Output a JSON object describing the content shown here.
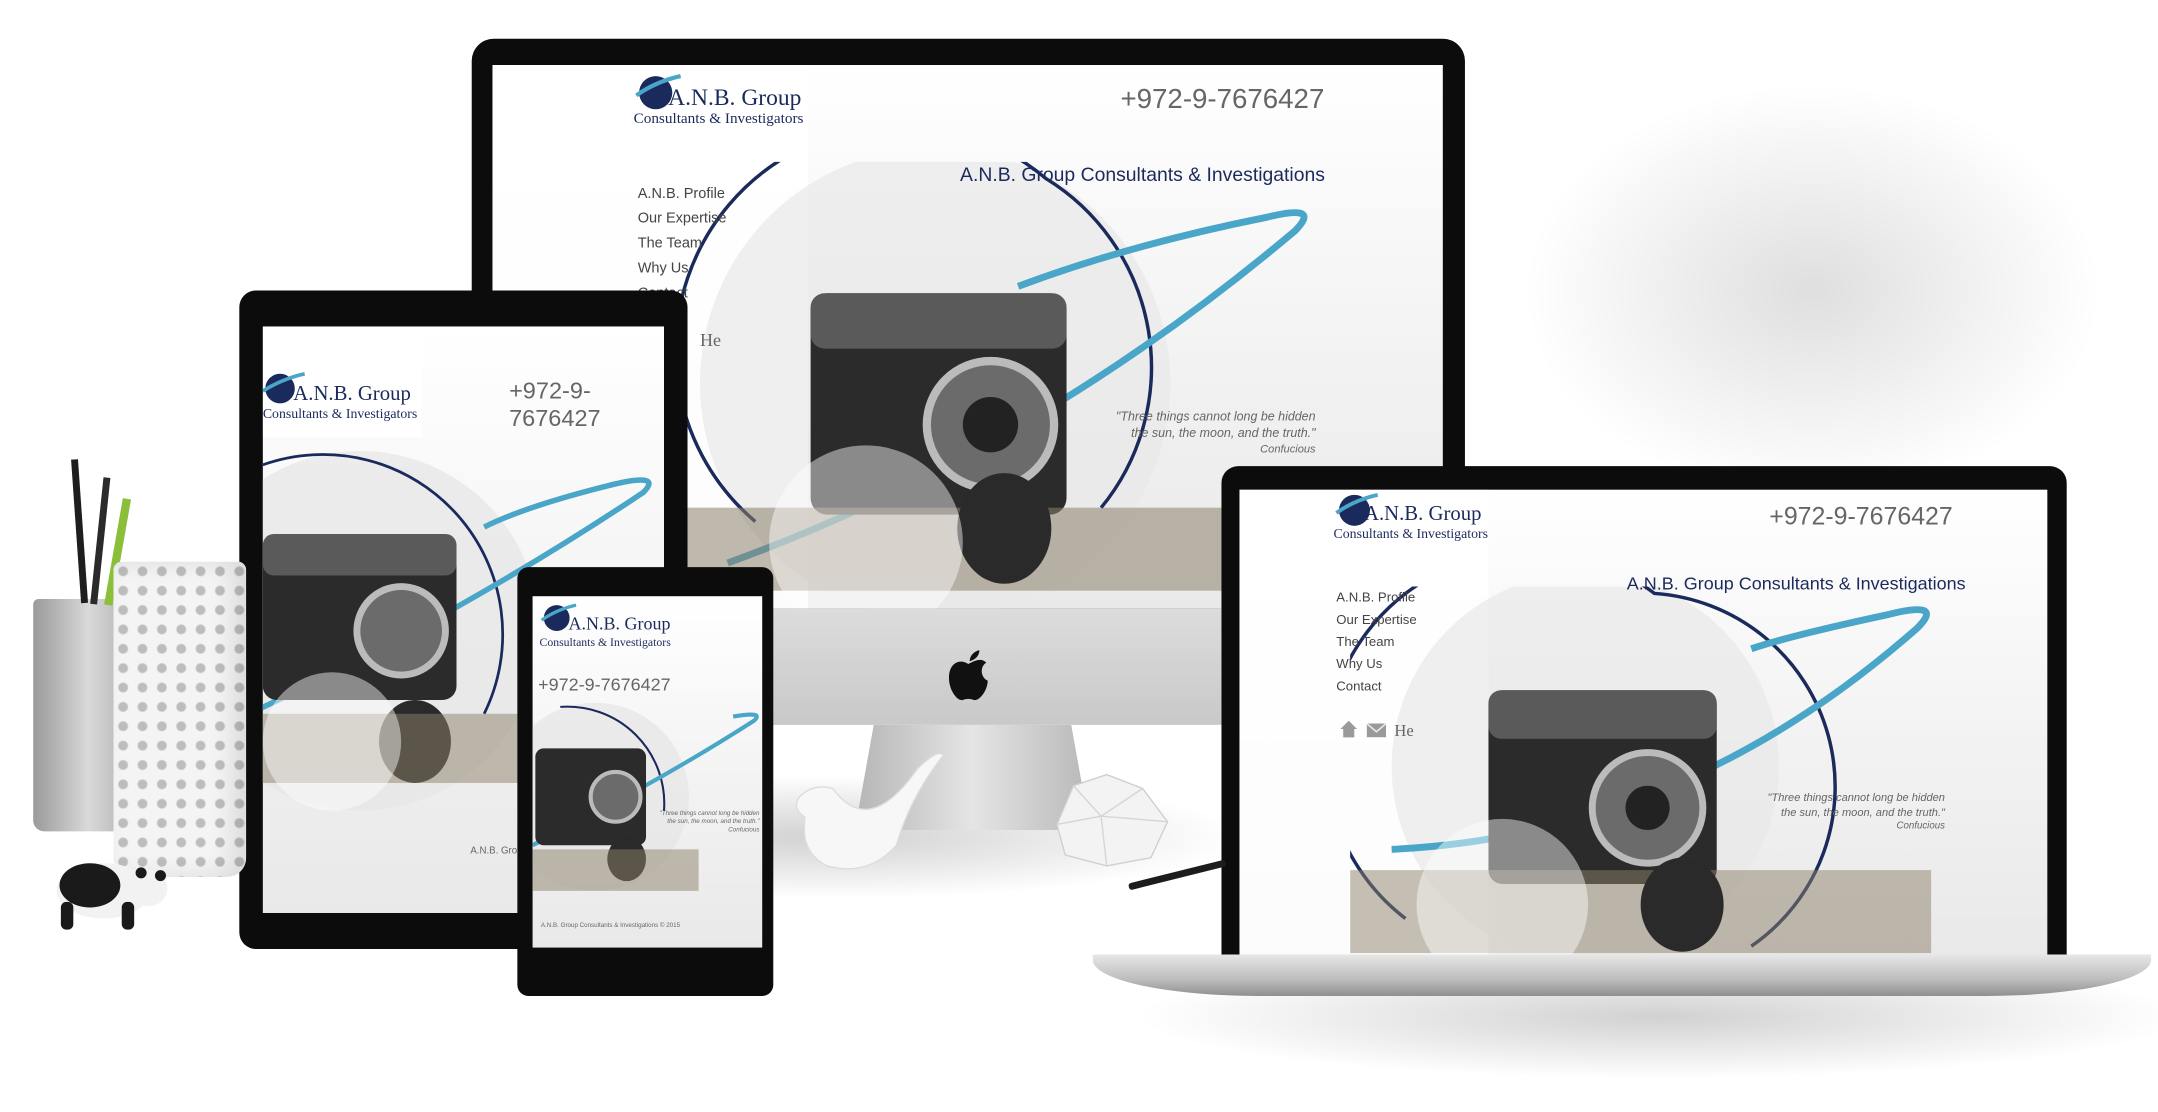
{
  "site": {
    "logo_title": "A.N.B. Group",
    "logo_subtitle": "Consultants & Investigators",
    "phone": "+972-9-7676427",
    "headline": "A.N.B. Group Consultants & Investigations",
    "nav": [
      "A.N.B. Profile",
      "Our Expertise",
      "The Team",
      "Why Us",
      "Contact"
    ],
    "lang_label": "He",
    "quote_line1": "\"Three things cannot long be hidden",
    "quote_line2": "the sun, the moon, and the truth.\"",
    "quote_author": "Confucious",
    "footer_tablet": "A.N.B. Grou",
    "footer_phone": "A.N.B. Group Consultants & Investigations © 2015"
  },
  "icons": [
    "house-icon",
    "envelope-icon",
    "apple-logo-icon"
  ],
  "colors": {
    "navy": "#1b2a5c",
    "teal": "#4aa6c8",
    "frame": "#0c0c0c",
    "text_grey": "#666666"
  }
}
